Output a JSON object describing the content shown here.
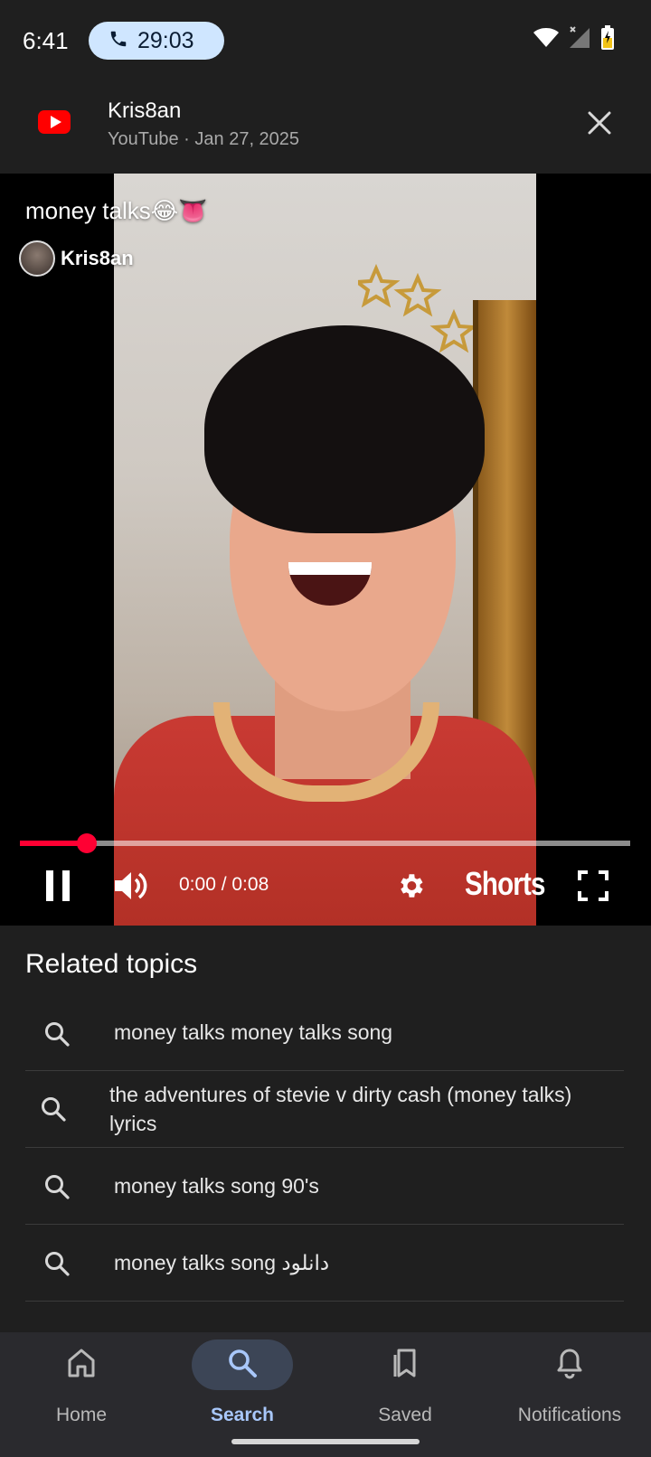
{
  "status_bar": {
    "time": "6:41",
    "call_timer": "29:03",
    "icons": [
      "phone-icon",
      "wifi-icon",
      "signal-icon",
      "battery-icon"
    ]
  },
  "header": {
    "title": "Kris8an",
    "source": "YouTube",
    "separator": "·",
    "date": "Jan 27, 2025",
    "logo_icon": "youtube-logo-icon",
    "close_icon": "close-icon"
  },
  "video": {
    "title": "money talks😂👅",
    "channel": "Kris8an",
    "progress_fraction": 0.11,
    "time_display": "0:00 / 0:08",
    "shorts_label": "Shorts",
    "accent_color": "#ff0033",
    "icons": [
      "pause-icon",
      "volume-icon",
      "settings-icon",
      "fullscreen-icon"
    ]
  },
  "related": {
    "heading": "Related topics",
    "items": [
      "money talks money talks song",
      "the adventures of stevie v dirty cash (money talks) lyrics",
      "money talks song 90's",
      "money talks song دانلود"
    ]
  },
  "bottom_nav": {
    "items": [
      {
        "label": "Home",
        "icon": "home-icon",
        "active": false
      },
      {
        "label": "Search",
        "icon": "search-icon",
        "active": true
      },
      {
        "label": "Saved",
        "icon": "saved-icon",
        "active": false
      },
      {
        "label": "Notifications",
        "icon": "bell-icon",
        "active": false
      }
    ],
    "active_color": "#a8c7fa"
  }
}
